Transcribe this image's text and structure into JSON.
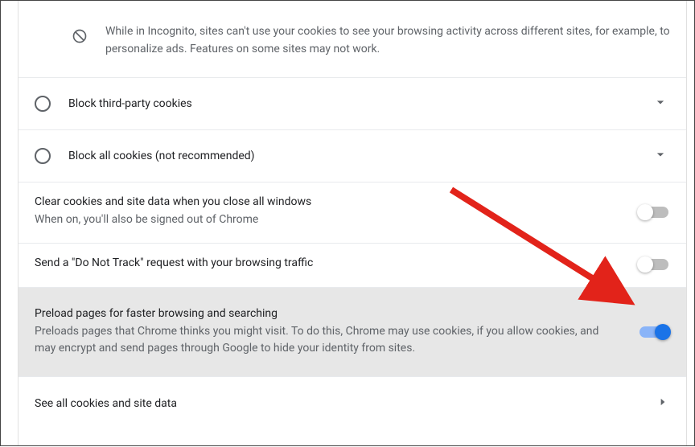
{
  "incognito_desc": "While in Incognito, sites can't use your cookies to see your browsing activity across different sites, for example, to personalize ads. Features on some sites may not work.",
  "radios": {
    "block_third_party": "Block third-party cookies",
    "block_all": "Block all cookies (not recommended)"
  },
  "settings": {
    "clear_on_close": {
      "title": "Clear cookies and site data when you close all windows",
      "sub": "When on, you'll also be signed out of Chrome",
      "on": false
    },
    "do_not_track": {
      "title": "Send a \"Do Not Track\" request with your browsing traffic",
      "on": false
    },
    "preload": {
      "title": "Preload pages for faster browsing and searching",
      "sub": "Preloads pages that Chrome thinks you might visit. To do this, Chrome may use cookies, if you allow cookies, and may encrypt and send pages through Google to hide your identity from sites.",
      "on": true
    }
  },
  "see_all": "See all cookies and site data"
}
